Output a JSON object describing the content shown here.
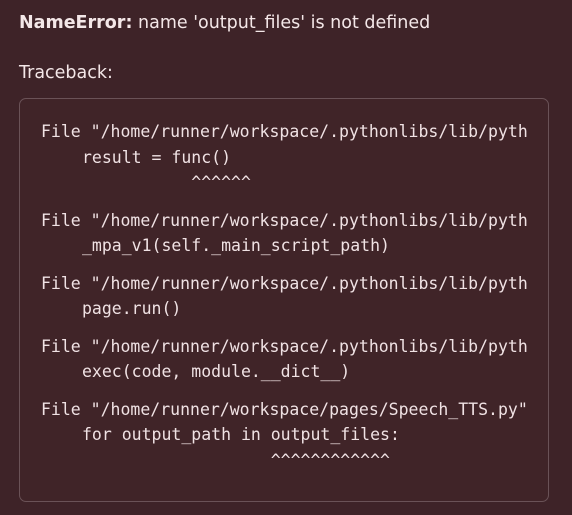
{
  "error": {
    "type": "NameError",
    "separator": ":",
    "message": " name 'output_files' is not defined"
  },
  "traceback": {
    "label": "Traceback:",
    "frames": [
      {
        "file_line": "File \"/home/runner/workspace/.pythonlibs/lib/pyth",
        "code": "result = func()",
        "marker": "           ^^^^^^"
      },
      {
        "file_line": "File \"/home/runner/workspace/.pythonlibs/lib/pyth",
        "code": "_mpa_v1(self._main_script_path)",
        "marker": ""
      },
      {
        "file_line": "File \"/home/runner/workspace/.pythonlibs/lib/pyth",
        "code": "page.run()",
        "marker": ""
      },
      {
        "file_line": "File \"/home/runner/workspace/.pythonlibs/lib/pyth",
        "code": "exec(code, module.__dict__)",
        "marker": ""
      },
      {
        "file_line": "File \"/home/runner/workspace/pages/Speech_TTS.py\"",
        "code": "for output_path in output_files:",
        "marker": "                   ^^^^^^^^^^^^"
      }
    ]
  }
}
